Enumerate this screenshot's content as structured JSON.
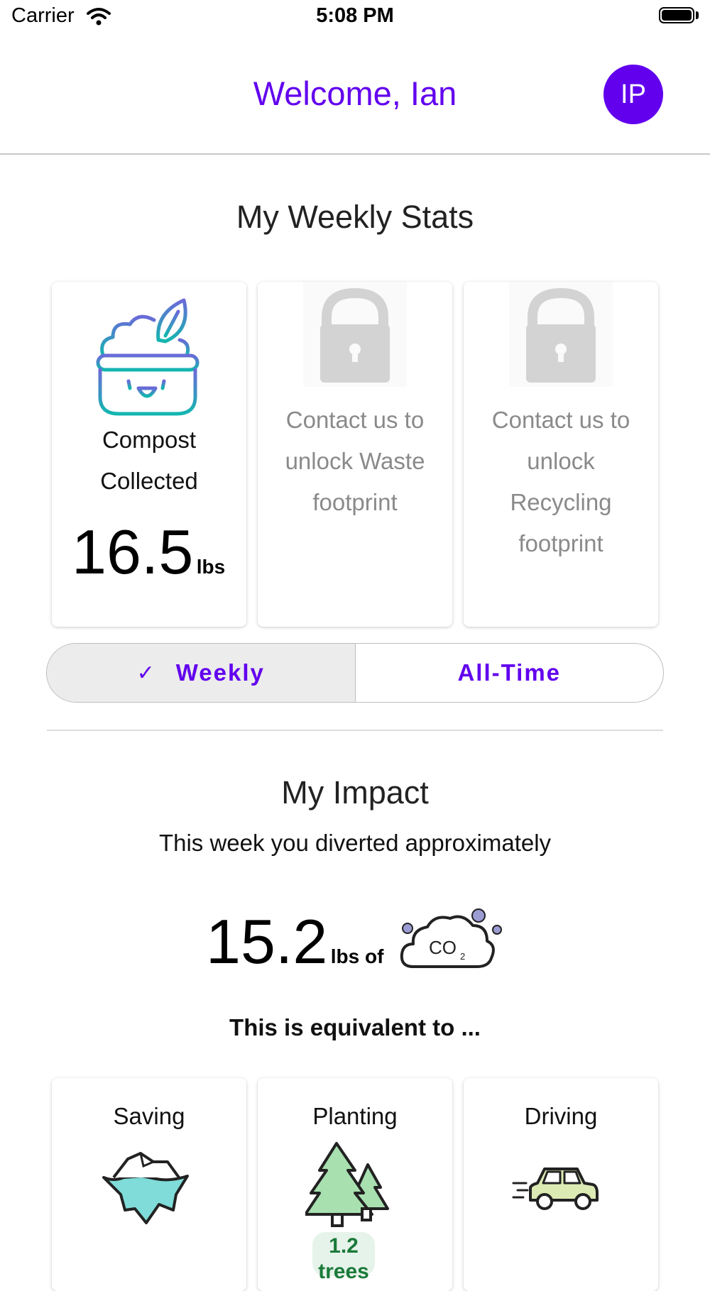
{
  "status_bar": {
    "carrier": "Carrier",
    "time": "5:08 PM"
  },
  "header": {
    "welcome": "Welcome, Ian",
    "avatar_initials": "IP"
  },
  "weekly_stats": {
    "title": "My Weekly Stats",
    "cards": [
      {
        "label_line1": "Compost",
        "label_line2": "Collected",
        "value": "16.5",
        "unit": "lbs"
      },
      {
        "locked_line1": "Contact us to",
        "locked_line2": "unlock Waste",
        "locked_line3": "footprint"
      },
      {
        "locked_line1": "Contact us to",
        "locked_line2": "unlock",
        "locked_line3": "Recycling",
        "locked_line4": "footprint"
      }
    ]
  },
  "period_toggle": {
    "weekly_label": "Weekly",
    "alltime_label": "All-Time",
    "selected": "Weekly"
  },
  "impact": {
    "title": "My Impact",
    "subtitle": "This week you diverted approximately",
    "value": "15.2",
    "unit": "lbs of",
    "co2_label": "CO",
    "co2_sub": "2",
    "equivalent_heading": "This is equivalent to ...",
    "equivalents": [
      {
        "label": "Saving"
      },
      {
        "label": "Planting",
        "value_line1": "1.2",
        "value_line2": "trees"
      },
      {
        "label": "Driving"
      }
    ]
  },
  "colors": {
    "accent": "#6200ee",
    "locked_text": "#8a8a8a",
    "compost_gradient_start": "#6a6ad8",
    "compost_gradient_end": "#13b7b0"
  },
  "icons": [
    "wifi-icon",
    "battery-icon",
    "compost-icon",
    "lock-icon",
    "check-icon",
    "co2-cloud-icon",
    "iceberg-icon",
    "trees-icon",
    "car-icon"
  ]
}
